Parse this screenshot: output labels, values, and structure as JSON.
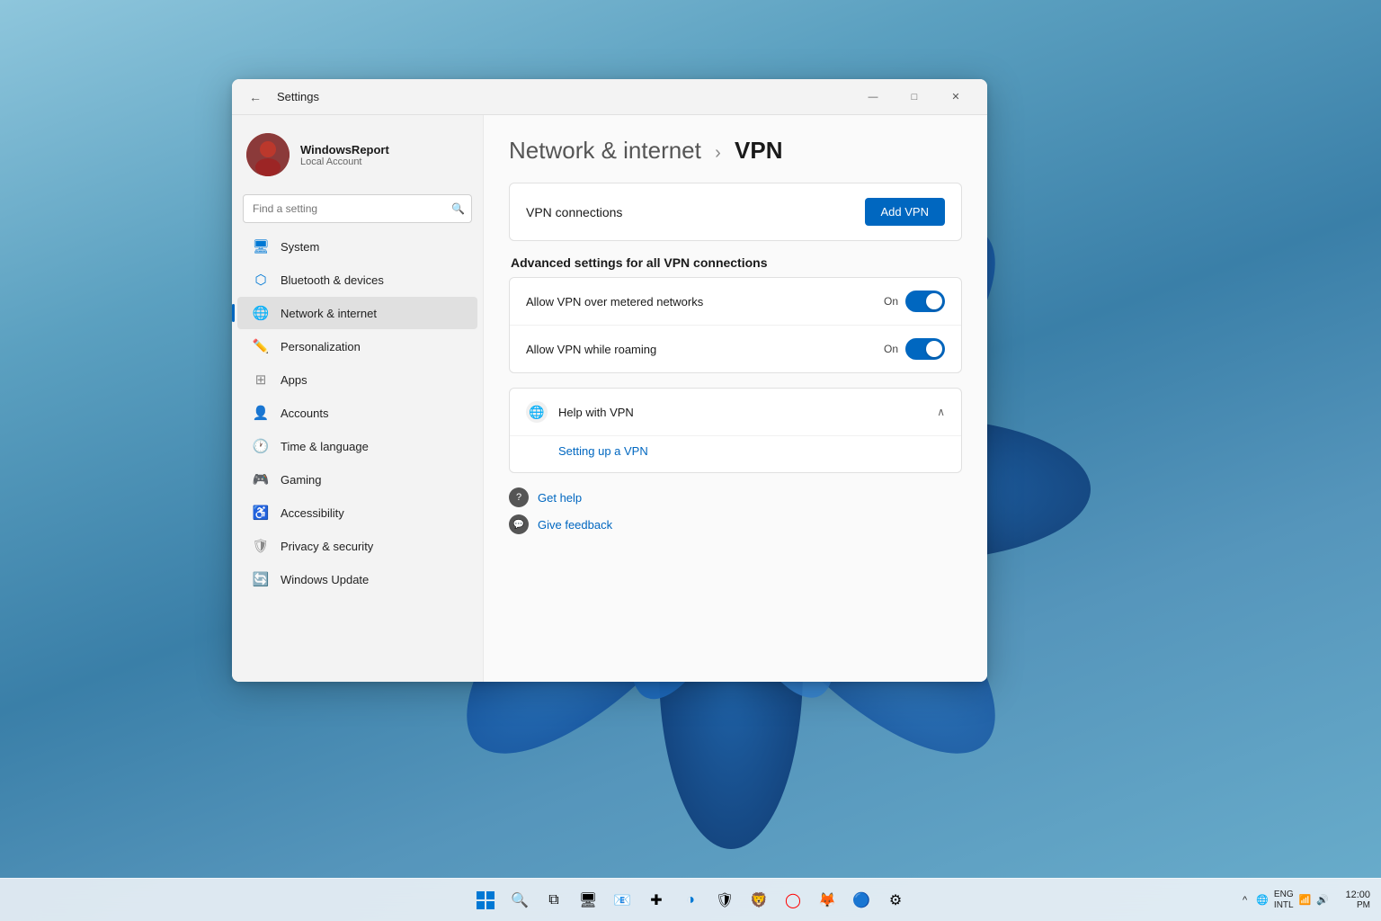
{
  "window": {
    "title": "Settings",
    "back_tooltip": "Back"
  },
  "titlebar": {
    "minimize": "—",
    "maximize": "□",
    "close": "✕"
  },
  "user": {
    "name": "WindowsReport",
    "account_type": "Local Account",
    "avatar_initial": "👤"
  },
  "search": {
    "placeholder": "Find a setting",
    "icon": "🔍"
  },
  "nav": {
    "items": [
      {
        "id": "system",
        "label": "System",
        "icon": "🖥",
        "active": false
      },
      {
        "id": "bluetooth",
        "label": "Bluetooth & devices",
        "icon": "🔵",
        "active": false
      },
      {
        "id": "network",
        "label": "Network & internet",
        "icon": "🌐",
        "active": true
      },
      {
        "id": "personalization",
        "label": "Personalization",
        "icon": "✏️",
        "active": false
      },
      {
        "id": "apps",
        "label": "Apps",
        "icon": "📦",
        "active": false
      },
      {
        "id": "accounts",
        "label": "Accounts",
        "icon": "👤",
        "active": false
      },
      {
        "id": "time",
        "label": "Time & language",
        "icon": "🕐",
        "active": false
      },
      {
        "id": "gaming",
        "label": "Gaming",
        "icon": "🎮",
        "active": false
      },
      {
        "id": "accessibility",
        "label": "Accessibility",
        "icon": "♿",
        "active": false
      },
      {
        "id": "privacy",
        "label": "Privacy & security",
        "icon": "🔒",
        "active": false
      },
      {
        "id": "update",
        "label": "Windows Update",
        "icon": "🔄",
        "active": false
      }
    ]
  },
  "content": {
    "breadcrumb_parent": "Network & internet",
    "breadcrumb_sep": "›",
    "breadcrumb_current": "VPN",
    "vpn_connections_label": "VPN connections",
    "add_vpn_button": "Add VPN",
    "advanced_section_title": "Advanced settings for all VPN connections",
    "toggle_on_label": "On",
    "settings": [
      {
        "id": "metered",
        "label": "Allow VPN over metered networks",
        "value": "On",
        "enabled": true
      },
      {
        "id": "roaming",
        "label": "Allow VPN while roaming",
        "value": "On",
        "enabled": true
      }
    ],
    "help_section": {
      "title": "Help with VPN",
      "icon": "🌐",
      "expanded": true,
      "links": [
        {
          "id": "setup",
          "label": "Setting up a VPN"
        }
      ]
    },
    "bottom_links": [
      {
        "id": "get-help",
        "icon": "❓",
        "label": "Get help"
      },
      {
        "id": "give-feedback",
        "icon": "💬",
        "label": "Give feedback"
      }
    ]
  },
  "taskbar": {
    "start_icon": "⊞",
    "search_icon": "🔍",
    "task_view": "⧉",
    "icons": [
      "📧",
      "✚",
      "🌐",
      "🛡",
      "🔴",
      "🟠",
      "🔵",
      "⚙"
    ],
    "system_tray": {
      "chevron": "^",
      "globe": "🌐",
      "lang": "ENG\nINTL",
      "wifi": "📶",
      "volume": "🔊",
      "time": "12:00",
      "date": "PM"
    }
  }
}
